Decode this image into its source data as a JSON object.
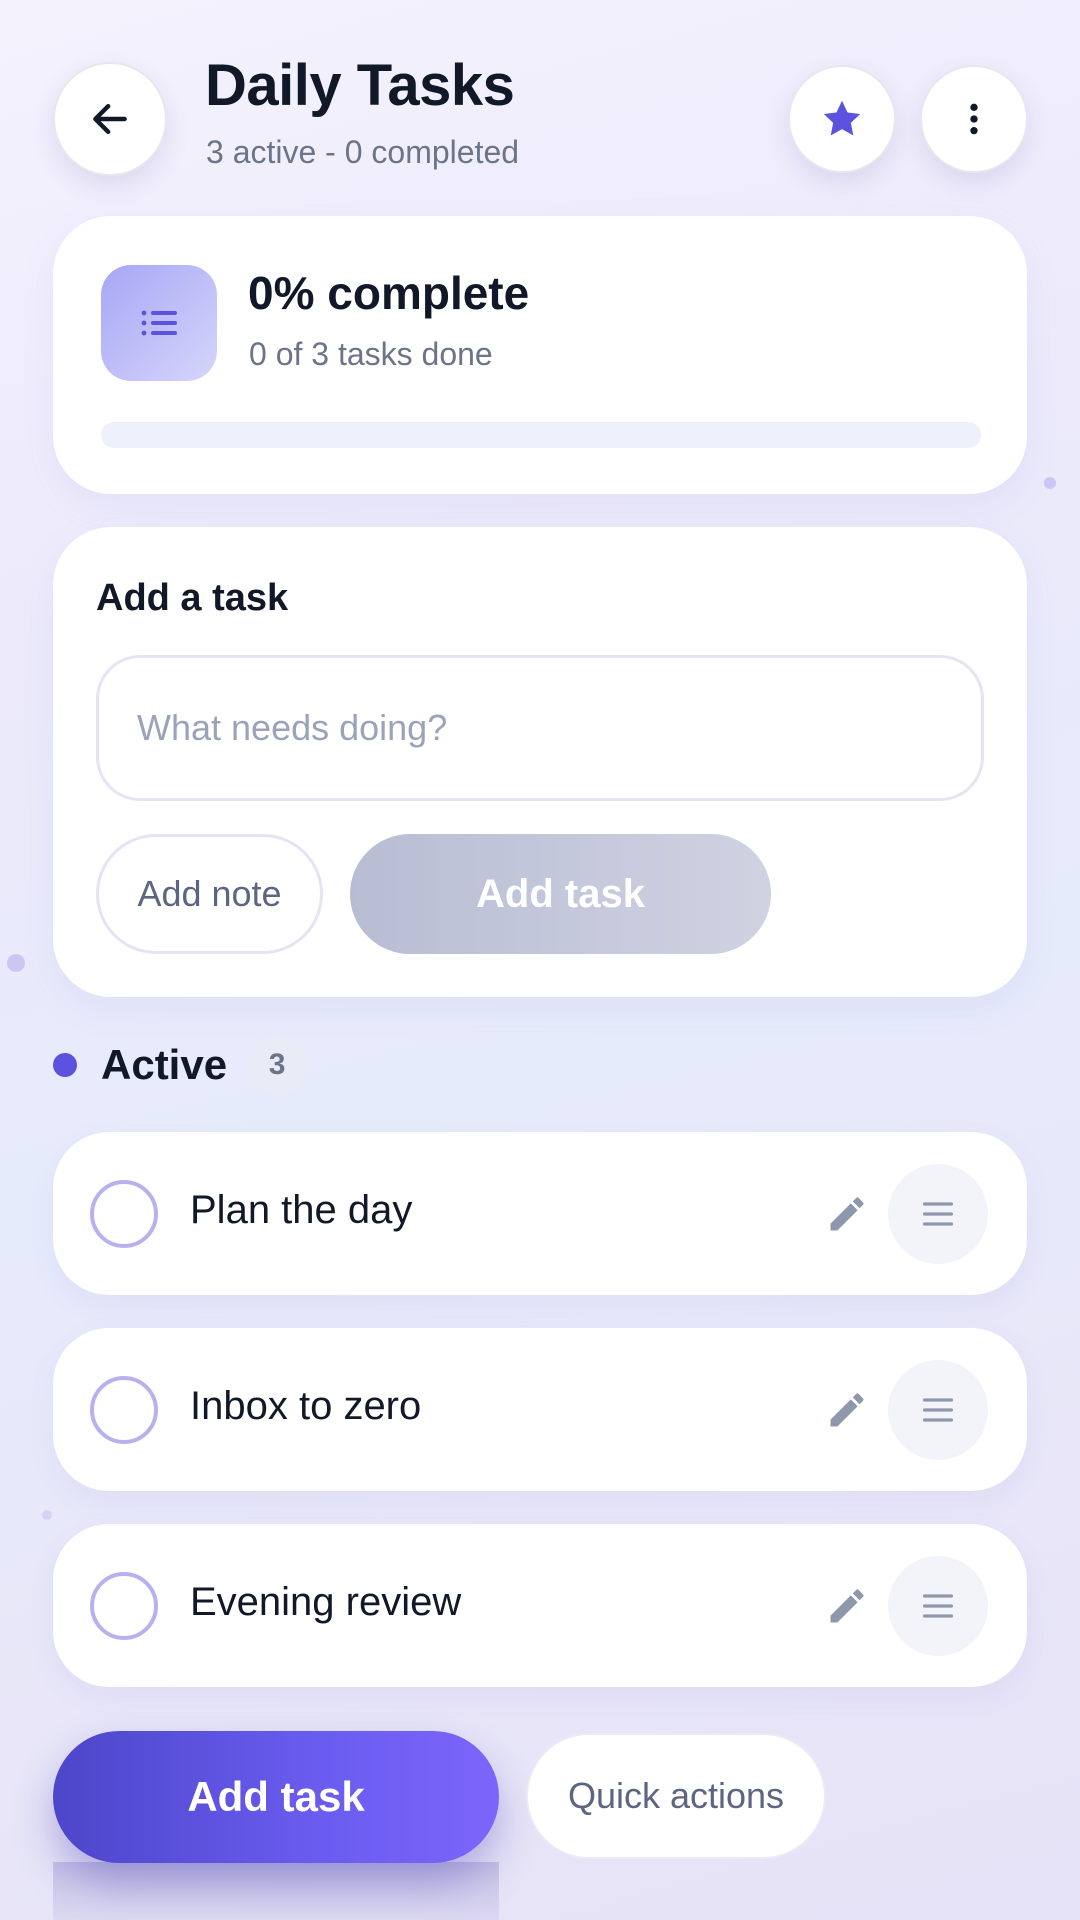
{
  "header": {
    "title": "Daily Tasks",
    "subtitle": "3 active - 0 completed",
    "back_icon": "arrow-left-icon",
    "favorite_icon": "star-icon",
    "menu_icon": "more-vertical-icon"
  },
  "progress": {
    "title": "0% complete",
    "subtitle": "0 of 3 tasks done",
    "percent": 0,
    "icon": "list-icon"
  },
  "add_task": {
    "heading": "Add a task",
    "input_value": "",
    "input_placeholder": "What needs doing?",
    "add_note_label": "Add note",
    "add_task_label": "Add task"
  },
  "section": {
    "label": "Active",
    "count": "3"
  },
  "tasks": [
    {
      "label": "Plan the day",
      "completed": false
    },
    {
      "label": "Inbox to zero",
      "completed": false
    },
    {
      "label": "Evening review",
      "completed": false
    }
  ],
  "bottom": {
    "primary_label": "Add task",
    "secondary_label": "Quick actions"
  },
  "colors": {
    "accent": "#6a5cf0",
    "accent_dark": "#4c46c9",
    "text": "#111827",
    "muted": "#6b7489"
  }
}
